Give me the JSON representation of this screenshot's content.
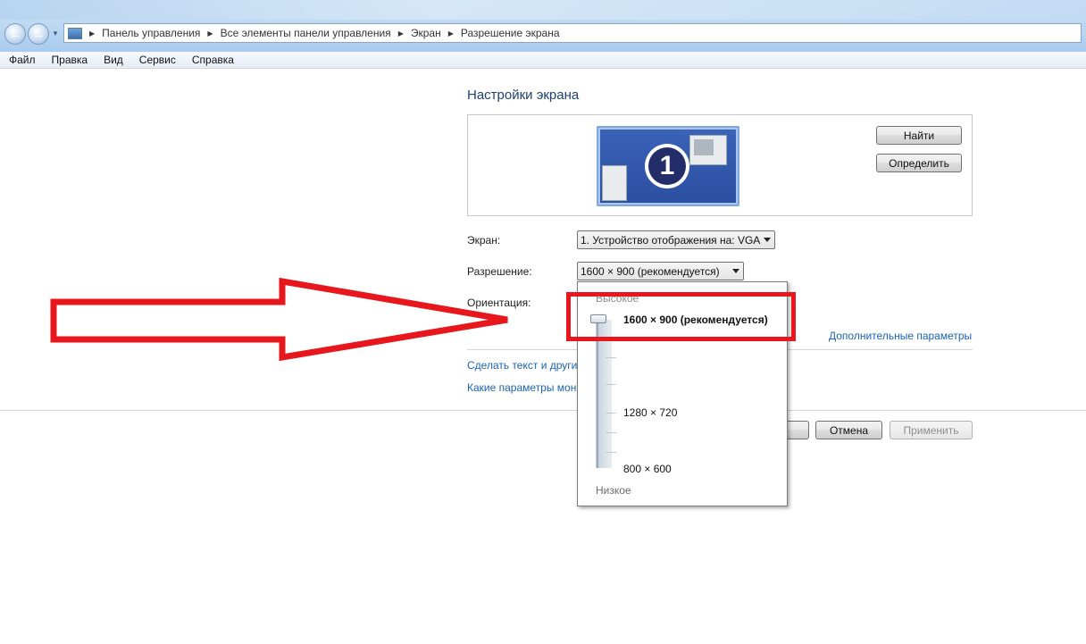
{
  "address_bar": {
    "crumbs": [
      "Панель управления",
      "Все элементы панели управления",
      "Экран",
      "Разрешение экрана"
    ]
  },
  "menu": {
    "items": [
      "Файл",
      "Правка",
      "Вид",
      "Сервис",
      "Справка"
    ]
  },
  "main": {
    "heading": "Настройки экрана",
    "monitor_number": "1",
    "find_button": "Найти",
    "identify_button": "Определить",
    "display_label": "Экран:",
    "display_value": "1. Устройство отображения на: VGA",
    "resolution_label": "Разрешение:",
    "resolution_value": "1600 × 900 (рекомендуется)",
    "orientation_label": "Ориентация:",
    "advanced_link": "Дополнительные параметры",
    "text_link": "Сделать текст и другие",
    "params_link": "Какие параметры мон",
    "ok_button": "",
    "cancel_button": "Отмена",
    "apply_button": "Применить"
  },
  "resolution_popup": {
    "high_label": "Высокое",
    "low_label": "Низкое",
    "options": [
      "1600 × 900 (рекомендуется)",
      "1280 × 720",
      "800 × 600"
    ],
    "selected_fraction": 1.0
  },
  "colors": {
    "annotation": "#e8171e",
    "link": "#1a63b6",
    "heading": "#1e3f75"
  }
}
